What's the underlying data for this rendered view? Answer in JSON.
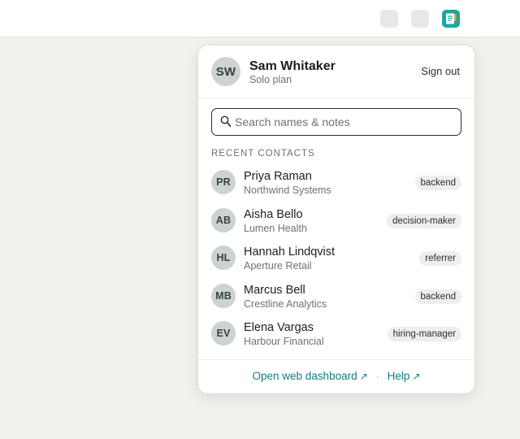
{
  "user": {
    "initials": "SW",
    "name": "Sam Whitaker",
    "plan": "Solo plan",
    "sign_out_label": "Sign out"
  },
  "search": {
    "placeholder": "Search names & notes",
    "value": ""
  },
  "recent": {
    "label": "RECENT CONTACTS",
    "items": [
      {
        "initials": "PR",
        "name": "Priya Raman",
        "org": "Northwind Systems",
        "tag": "backend"
      },
      {
        "initials": "AB",
        "name": "Aisha Bello",
        "org": "Lumen Health",
        "tag": "decision-maker"
      },
      {
        "initials": "HL",
        "name": "Hannah Lindqvist",
        "org": "Aperture Retail",
        "tag": "referrer"
      },
      {
        "initials": "MB",
        "name": "Marcus Bell",
        "org": "Crestline Analytics",
        "tag": "backend"
      },
      {
        "initials": "EV",
        "name": "Elena Vargas",
        "org": "Harbour Financial",
        "tag": "hiring-manager"
      }
    ]
  },
  "footer": {
    "dashboard_label": "Open web dashboard",
    "help_label": "Help",
    "separator": "·",
    "external_arrow": "↗"
  },
  "icons": {
    "toolbar_extension": "contacts-extension-icon",
    "search": "search-icon"
  },
  "colors": {
    "accent": "#0f7f82",
    "extension": "#1aa7a4",
    "avatar_bg": "#ccd3d2"
  }
}
